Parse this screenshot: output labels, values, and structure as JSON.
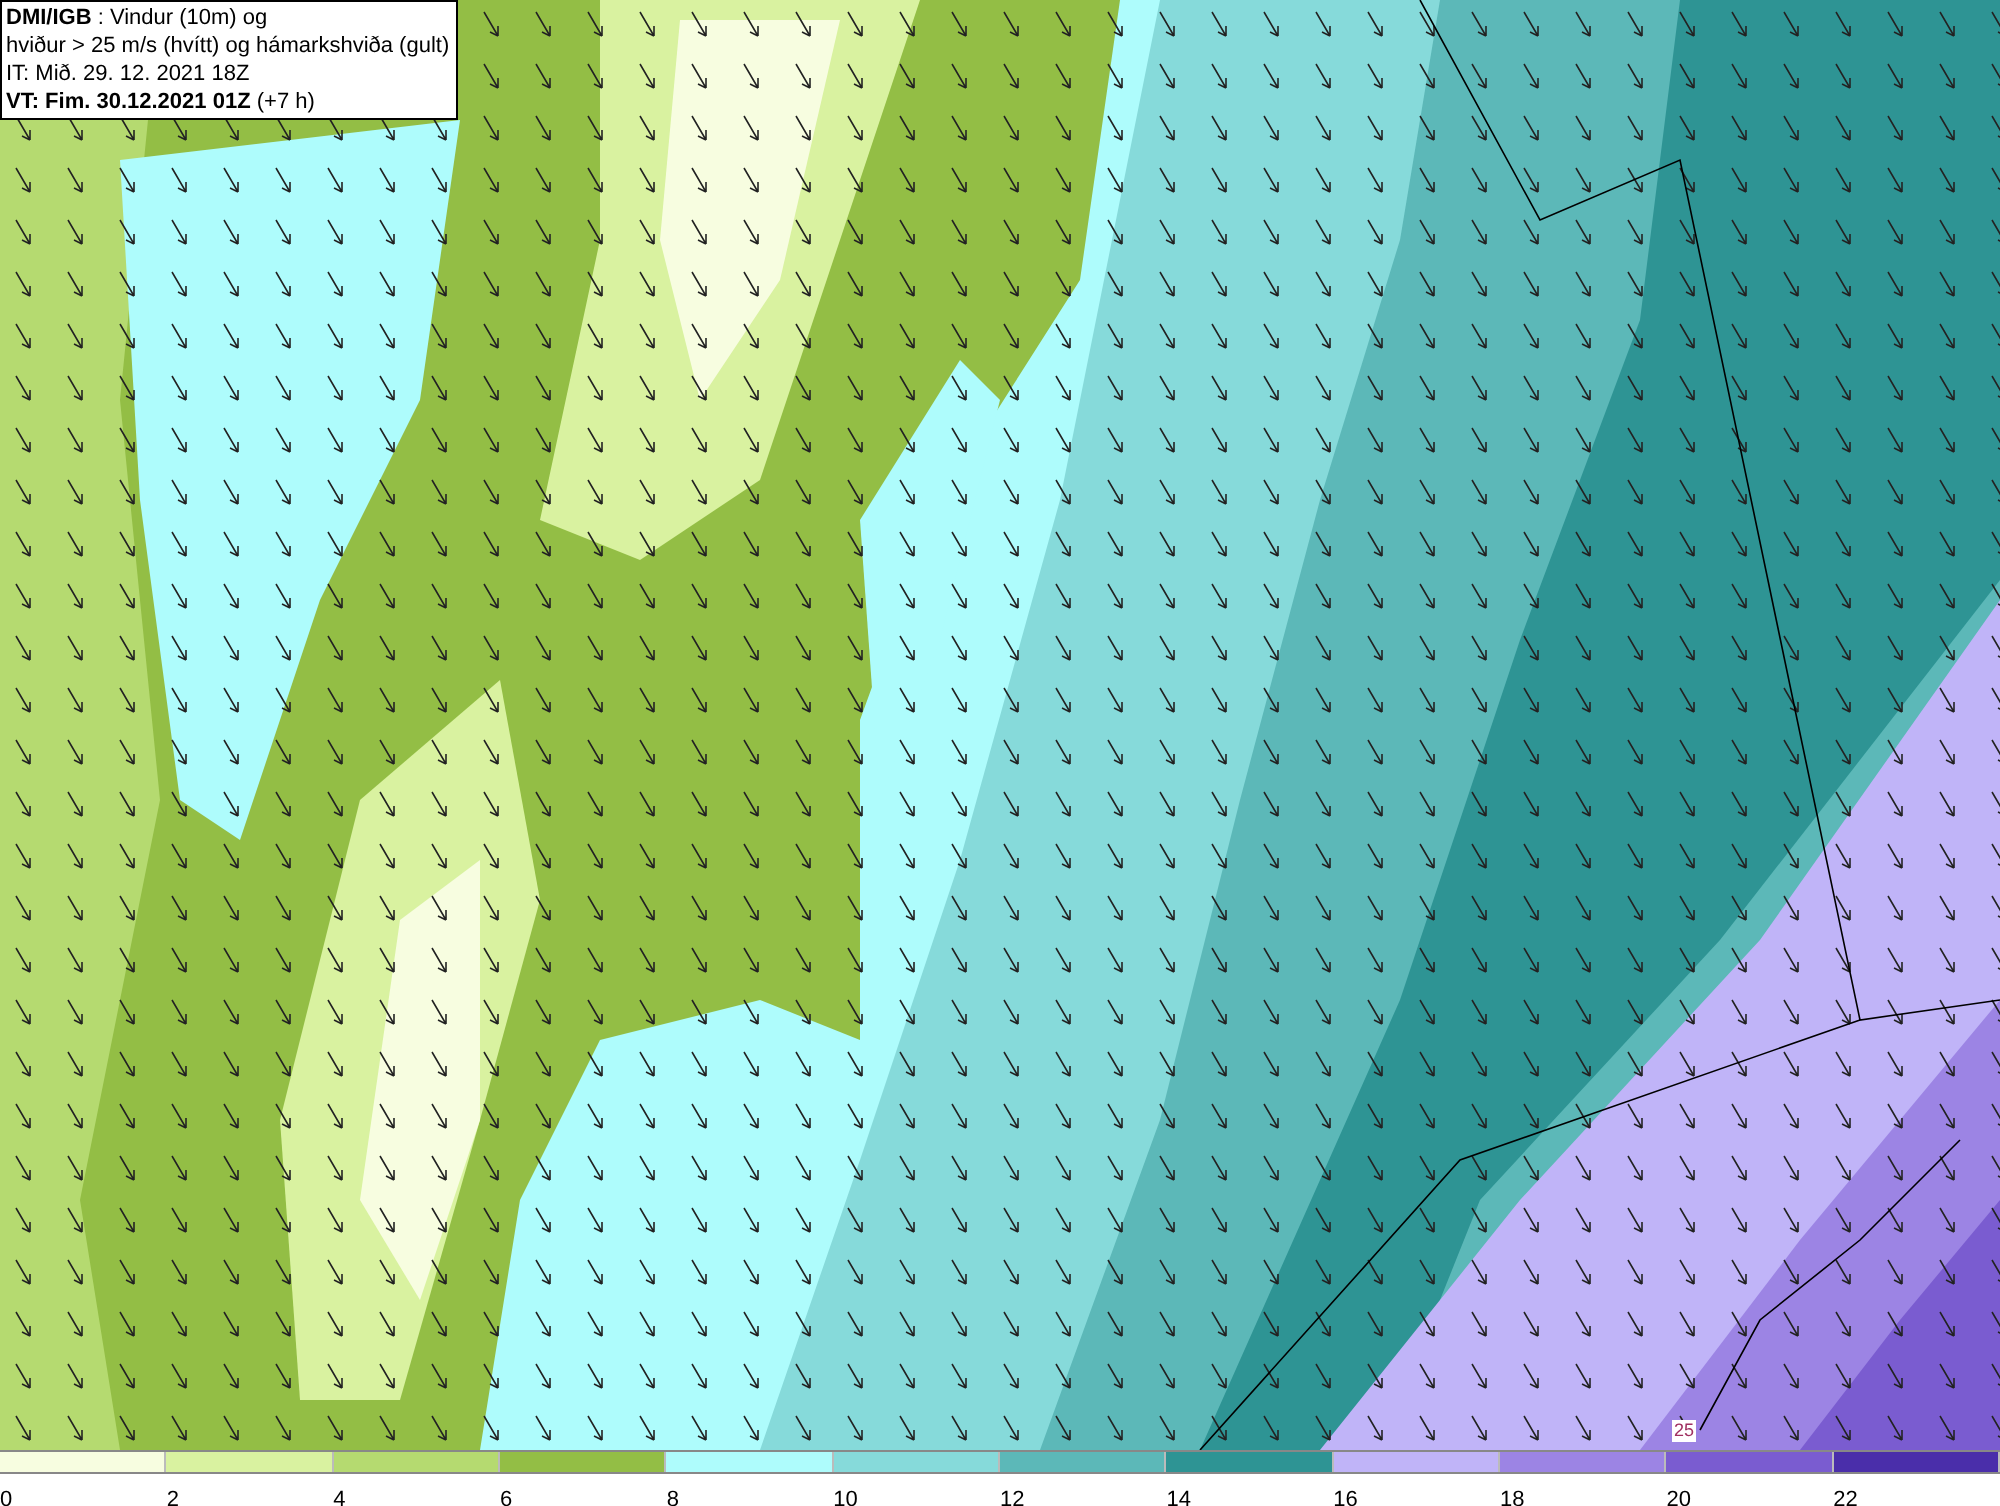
{
  "title_box": {
    "lines": [
      "**DMI/IGB** : Vindur (10m) og",
      "hviður > 25 m/s (hvítt) og hámarkshviða (gult)",
      "IT: Mið. 29. 12. 2021 18Z",
      "**VT: Fim. 30.12.2021 01Z** (+7 h)"
    ]
  },
  "map": {
    "contour_label": "25"
  },
  "legend": {
    "swatches": [
      {
        "color": "#f7fde0"
      },
      {
        "color": "#d9f2a0"
      },
      {
        "color": "#b5da70"
      },
      {
        "color": "#93be45"
      },
      {
        "color": "#aefcfc"
      },
      {
        "color": "#86dada"
      },
      {
        "color": "#5cb8b8"
      },
      {
        "color": "#2e9494"
      },
      {
        "color": "#c0b4f8"
      },
      {
        "color": "#9c84e4"
      },
      {
        "color": "#7a5cd0"
      },
      {
        "color": "#4a2eaa"
      }
    ],
    "ticks": [
      "0",
      "2",
      "4",
      "6",
      "8",
      "10",
      "12",
      "14",
      "16",
      "18",
      "20",
      "22"
    ]
  }
}
